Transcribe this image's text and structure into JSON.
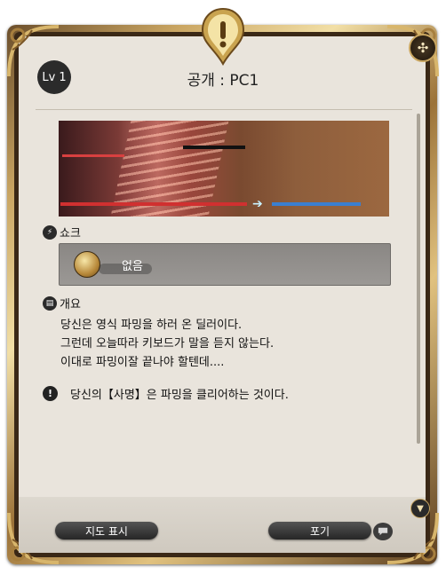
{
  "header": {
    "level_badge": "Lv 1",
    "title": "공개 : PC1"
  },
  "reward": {
    "label": "쇼크",
    "item_name": "없음"
  },
  "description": {
    "label": "개요",
    "text": "당신은 영식 파밍을 하러 온 딜러이다.\n그런데 오늘따라 키보드가 말을 듣지 않는다.\n이대로 파밍이잘 끝나야 할텐데...."
  },
  "objective": {
    "text": "당신의【사명】은 파밍을 클리어하는 것이다."
  },
  "footer": {
    "map_button": "지도 표시",
    "quit_button": "포기"
  },
  "icons": {
    "emblem": "exclamation-emblem-icon",
    "close": "settings-cross-icon",
    "reward": "shock-icon",
    "description": "book-icon",
    "objective": "exclamation-icon",
    "chat": "speech-bubble-icon",
    "scroll": "chevron-down-icon"
  },
  "colors": {
    "frame_gold": "#caa663",
    "panel_bg": "#e9e4dc",
    "button_dark": "#262626"
  }
}
